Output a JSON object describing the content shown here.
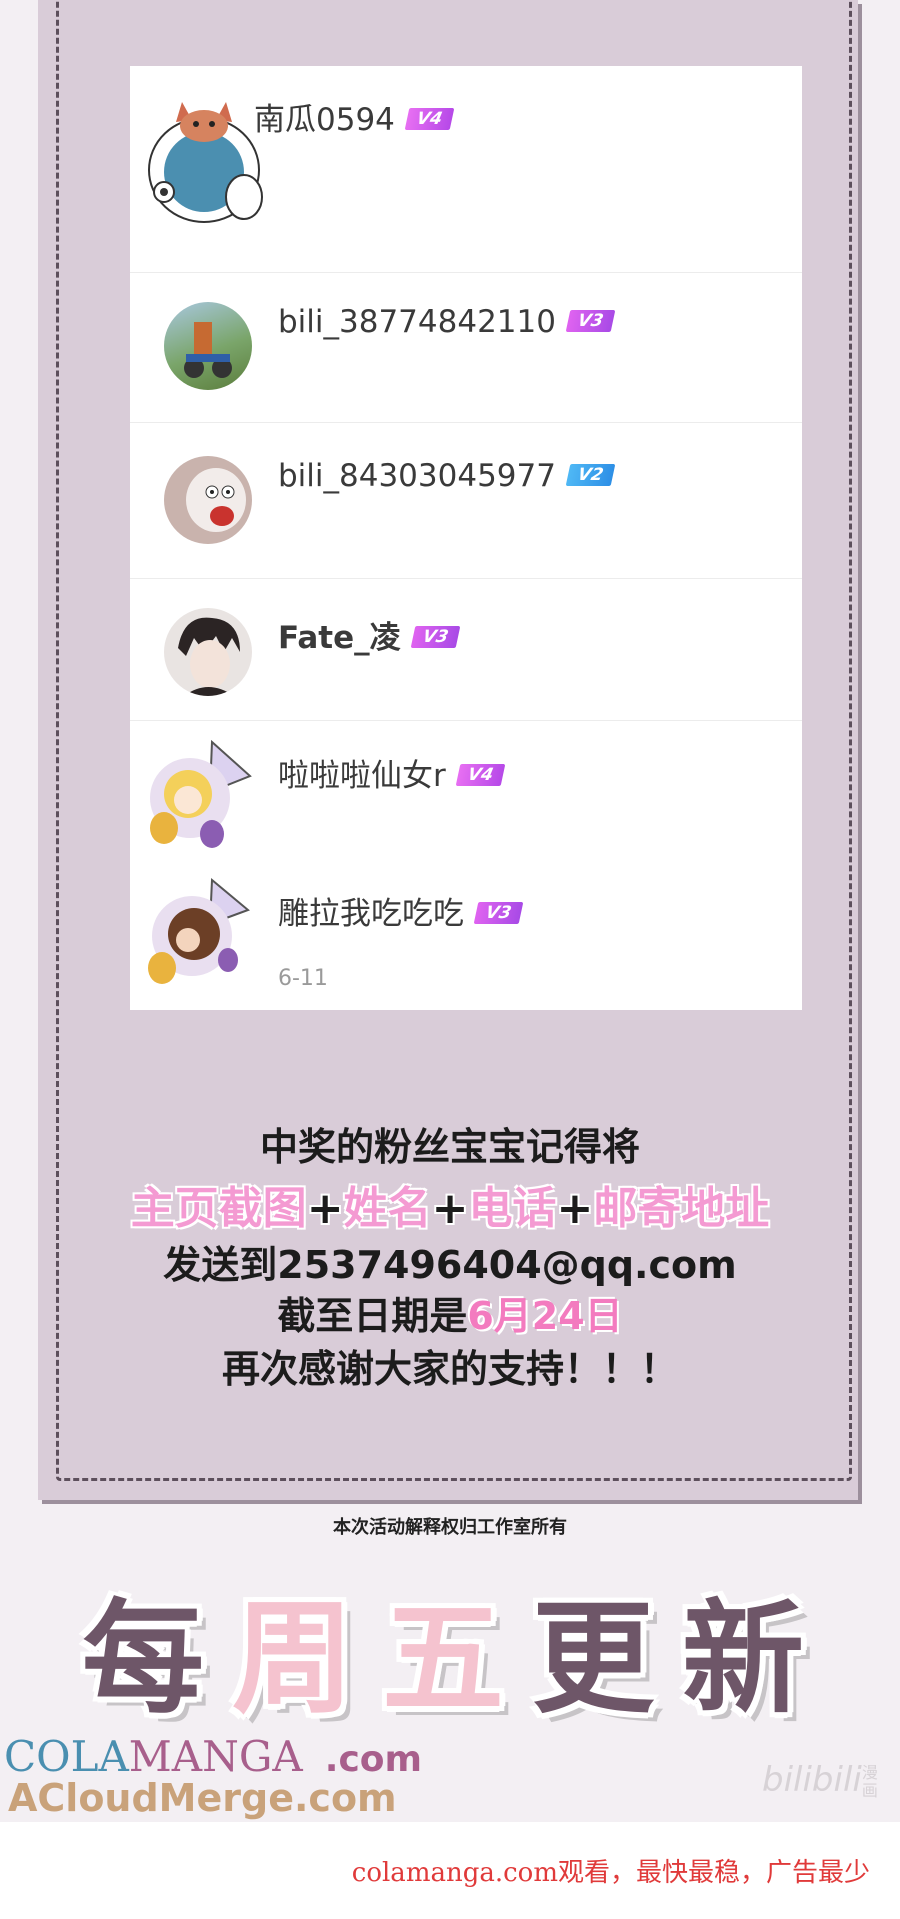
{
  "winners": [
    {
      "name": "南瓜0594",
      "level": "V4",
      "avatar": "fox-cat-avatar"
    },
    {
      "name": "bili_38774842110",
      "level": "V3",
      "avatar": "cartoon-scene-avatar"
    },
    {
      "name": "bili_84303045977",
      "level": "V2",
      "avatar": "screaming-sheep-avatar"
    },
    {
      "name": "Fate_凌",
      "level": "V3",
      "avatar": "anime-boy-avatar"
    },
    {
      "name": "啦啦啦仙女r",
      "level": "V4",
      "avatar": "blonde-girl-avatar"
    },
    {
      "name": "雕拉我吃吃吃",
      "level": "V3",
      "avatar": "chocolate-girl-avatar",
      "date": "6-11"
    }
  ],
  "notice": {
    "line1": "中奖的粉丝宝宝记得将",
    "line2_parts": [
      "主页截图",
      "+",
      "姓名",
      "+",
      "电话",
      "+",
      "邮寄地址"
    ],
    "line3": "发送到2537496404@qq.com",
    "line4_prefix": "截至日期是",
    "line4_date": "6月24日",
    "line5": "再次感谢大家的支持！！！"
  },
  "rights_text": "本次活动解释权归工作室所有",
  "weekly_banner": {
    "chars": [
      "每",
      "周",
      "五",
      "更",
      "新"
    ],
    "colors": [
      "#6e5668",
      "#f5c3cf",
      "#f5c3cf",
      "#6e5668",
      "#6e5668"
    ]
  },
  "watermark": {
    "cola": "COLA",
    "manga": "MANGA",
    "com": ".com",
    "site2": "ACloudMerge.com",
    "bilibili": "bilibili",
    "bilibili_sub": "漫画"
  },
  "footer_text": "colamanga.com观看，最快最稳，广告最少"
}
